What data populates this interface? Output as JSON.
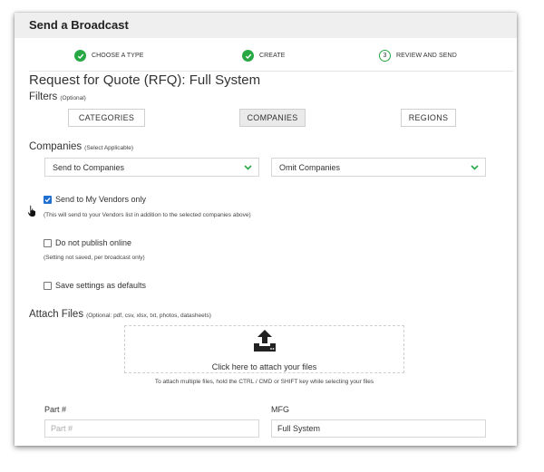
{
  "header": {
    "title": "Send a Broadcast"
  },
  "steps": [
    {
      "label": "CHOOSE A TYPE",
      "state": "done"
    },
    {
      "label": "CREATE",
      "state": "done"
    },
    {
      "label": "REVIEW AND SEND",
      "state": "current",
      "number": "3"
    }
  ],
  "page_title": "Request for Quote (RFQ): Full System",
  "filters": {
    "label": "Filters",
    "hint": "(Optional)",
    "buttons": [
      "CATEGORIES",
      "COMPANIES",
      "REGIONS"
    ],
    "active": "COMPANIES"
  },
  "companies": {
    "label": "Companies",
    "hint": "(Select Applicable)",
    "send_select": "Send to Companies",
    "omit_select": "Omit Companies"
  },
  "options": {
    "vendors_only": {
      "label": "Send to My Vendors only",
      "checked": true,
      "note": "(This will send to your Vendors list in addition to the selected companies above)"
    },
    "do_not_publish": {
      "label": "Do not publish online",
      "checked": false,
      "note": "(Setting not saved, per broadcast only)"
    },
    "save_defaults": {
      "label": "Save settings as defaults",
      "checked": false
    }
  },
  "attach": {
    "label": "Attach Files",
    "hint": "(Optional: pdf, csv, xlsx, txt, photos, datasheets)",
    "dropzone_text": "Click here to attach your files",
    "helper": "To attach multiple files, hold the CTRL / CMD or SHIFT key while selecting your files"
  },
  "fields": {
    "part_label": "Part #",
    "part_placeholder": "Part #",
    "part_value": "",
    "mfg_label": "MFG",
    "mfg_value": "Full System"
  },
  "colors": {
    "accent_green": "#27a844",
    "checkbox_blue": "#1f6fd1",
    "header_bg": "#efefef"
  }
}
